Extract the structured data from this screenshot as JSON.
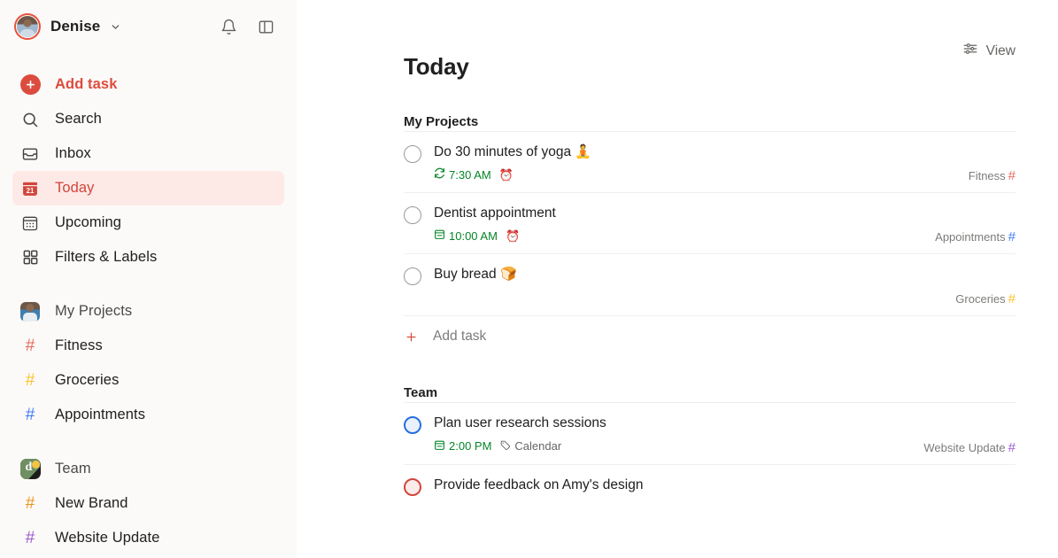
{
  "sidebar": {
    "user": {
      "name": "Denise",
      "avatar_icon": "user-photo-avatar",
      "chevron_icon": "chevron-down-icon"
    },
    "top_actions": [
      {
        "name": "notifications",
        "icon": "bell-icon"
      },
      {
        "name": "toggle-sidebar",
        "icon": "sidebar-panel-icon"
      }
    ],
    "nav": [
      {
        "label": "Add task",
        "icon": "plus-circle-icon",
        "style": "add"
      },
      {
        "label": "Search",
        "icon": "search-icon",
        "style": "normal"
      },
      {
        "label": "Inbox",
        "icon": "inbox-icon",
        "style": "normal"
      },
      {
        "label": "Today",
        "icon": "calendar-21-icon",
        "style": "active"
      },
      {
        "label": "Upcoming",
        "icon": "calendar-grid-icon",
        "style": "normal"
      },
      {
        "label": "Filters & Labels",
        "icon": "grid-squares-icon",
        "style": "normal"
      }
    ],
    "groups": [
      {
        "label": "My Projects",
        "icon": "my-projects-avatar",
        "projects": [
          {
            "label": "Fitness",
            "icon": "hash-icon",
            "color": "#E8675A"
          },
          {
            "label": "Groceries",
            "icon": "hash-icon",
            "color": "#FBC02D"
          },
          {
            "label": "Appointments",
            "icon": "hash-icon",
            "color": "#3E7BF5"
          }
        ]
      },
      {
        "label": "Team",
        "icon": "team-workspace-avatar",
        "projects": [
          {
            "label": "New Brand",
            "icon": "hash-icon",
            "color": "#F0921F"
          },
          {
            "label": "Website Update",
            "icon": "hash-icon",
            "color": "#9B59D0"
          }
        ]
      }
    ]
  },
  "main": {
    "view_button": {
      "label": "View",
      "icon": "sliders-icon"
    },
    "page_title": "Today",
    "sections": [
      {
        "heading": "My Projects",
        "tasks": [
          {
            "title": "Do 30 minutes of yoga",
            "emoji": "🧘",
            "priority": "p4",
            "date": "7:30 AM",
            "date_icon": "recurring-icon",
            "reminder_icon": "⏰",
            "project": "Fitness",
            "project_color": "#E8675A"
          },
          {
            "title": "Dentist appointment",
            "emoji": "",
            "priority": "p4",
            "date": "10:00 AM",
            "date_icon": "calendar-icon",
            "reminder_icon": "⏰",
            "project": "Appointments",
            "project_color": "#3E7BF5"
          },
          {
            "title": "Buy bread",
            "emoji": "🍞",
            "priority": "p4",
            "date": "",
            "date_icon": "",
            "reminder_icon": "",
            "project": "Groceries",
            "project_color": "#FBC02D"
          }
        ],
        "add_task_label": "Add task",
        "add_task_icon": "plus-icon"
      },
      {
        "heading": "Team",
        "tasks": [
          {
            "title": "Plan user research sessions",
            "emoji": "",
            "priority": "p3",
            "date": "2:00 PM",
            "date_icon": "calendar-icon",
            "label": "Calendar",
            "label_icon": "tag-icon",
            "project": "Website Update",
            "project_color": "#9B59D0"
          },
          {
            "title": "Provide feedback on Amy's design",
            "emoji": "",
            "priority": "p1",
            "date": "",
            "date_icon": "",
            "project": "",
            "project_color": "#9B59D0"
          }
        ]
      }
    ]
  },
  "colors": {
    "accent": "#DC4C3E",
    "sidebar_bg": "#FCFAF8",
    "active_bg": "#FDEAE7",
    "date_green": "#058527"
  }
}
